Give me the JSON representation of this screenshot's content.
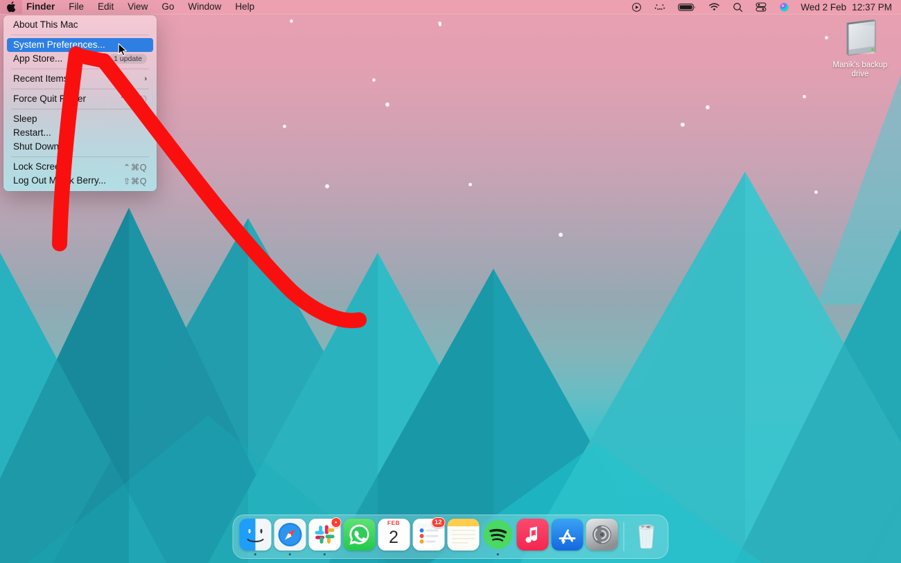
{
  "menubar": {
    "apple_icon": "apple-logo-icon",
    "items": [
      {
        "label": "Finder",
        "bold": true
      },
      {
        "label": "File",
        "bold": false
      },
      {
        "label": "Edit",
        "bold": false
      },
      {
        "label": "View",
        "bold": false
      },
      {
        "label": "Go",
        "bold": false
      },
      {
        "label": "Window",
        "bold": false
      },
      {
        "label": "Help",
        "bold": false
      }
    ],
    "status_icons": [
      "screen-recording-icon",
      "dots-pattern-icon",
      "battery-icon",
      "wifi-icon",
      "search-spotlight-icon",
      "control-center-icon",
      "siri-icon"
    ],
    "date": "Wed 2 Feb",
    "time": "12:37 PM",
    "background_color": "#eea0b0",
    "text_color": "#1b1b1b"
  },
  "apple_menu": {
    "highlight_color": "#2e7fe3",
    "groups": [
      [
        {
          "label": "About This Mac",
          "shortcut": "",
          "badge": "",
          "submenu": false,
          "selected": false
        }
      ],
      [
        {
          "label": "System Preferences...",
          "shortcut": "",
          "badge": "",
          "submenu": false,
          "selected": true
        },
        {
          "label": "App Store...",
          "shortcut": "",
          "badge": "1 update",
          "submenu": false,
          "selected": false
        }
      ],
      [
        {
          "label": "Recent Items",
          "shortcut": "",
          "badge": "",
          "submenu": true,
          "selected": false
        }
      ],
      [
        {
          "label": "Force Quit Finder",
          "shortcut": "⌥⌘⎋",
          "badge": "",
          "submenu": false,
          "selected": false
        }
      ],
      [
        {
          "label": "Sleep",
          "shortcut": "",
          "badge": "",
          "submenu": false,
          "selected": false
        },
        {
          "label": "Restart...",
          "shortcut": "",
          "badge": "",
          "submenu": false,
          "selected": false
        },
        {
          "label": "Shut Down...",
          "shortcut": "",
          "badge": "",
          "submenu": false,
          "selected": false
        }
      ],
      [
        {
          "label": "Lock Screen",
          "shortcut": "⌃⌘Q",
          "badge": "",
          "submenu": false,
          "selected": false
        },
        {
          "label": "Log Out Manik Berry...",
          "shortcut": "⇧⌘Q",
          "badge": "",
          "submenu": false,
          "selected": false
        }
      ]
    ]
  },
  "desktop": {
    "drive": {
      "icon": "external-hard-drive-icon",
      "label": "Manik's backup drive"
    },
    "wallpaper": {
      "name": "mountain-gradient-wallpaper",
      "sky_top_color": "#e8a0b0",
      "sky_bottom_color": "#18c3cf",
      "mountain_colors": [
        "#1f9aa8",
        "#17899a",
        "#2bb8c4",
        "#38c9d2",
        "#13788c"
      ]
    }
  },
  "annotation": {
    "color": "#fa0f0f",
    "shape": "hand-drawn-curved-arrow",
    "points_to": "System Preferences..."
  },
  "dock": {
    "background_color": "#98e2e6",
    "apps": [
      {
        "name": "finder",
        "label": "Finder",
        "running": true,
        "badge": ""
      },
      {
        "name": "safari",
        "label": "Safari",
        "running": true,
        "badge": ""
      },
      {
        "name": "slack",
        "label": "Slack",
        "running": true,
        "badge": "•"
      },
      {
        "name": "whatsapp",
        "label": "WhatsApp",
        "running": false,
        "badge": ""
      },
      {
        "name": "calendar",
        "label": "Calendar",
        "running": false,
        "badge": "",
        "month": "FEB",
        "day": "2"
      },
      {
        "name": "reminders",
        "label": "Reminders",
        "running": false,
        "badge": "12"
      },
      {
        "name": "notes",
        "label": "Notes",
        "running": false,
        "badge": ""
      },
      {
        "name": "spotify",
        "label": "Spotify",
        "running": true,
        "badge": ""
      },
      {
        "name": "music",
        "label": "Music",
        "running": false,
        "badge": ""
      },
      {
        "name": "app-store",
        "label": "App Store",
        "running": false,
        "badge": ""
      },
      {
        "name": "system-preferences",
        "label": "System Preferences",
        "running": false,
        "badge": ""
      }
    ],
    "trash": {
      "name": "trash",
      "label": "Trash"
    }
  }
}
